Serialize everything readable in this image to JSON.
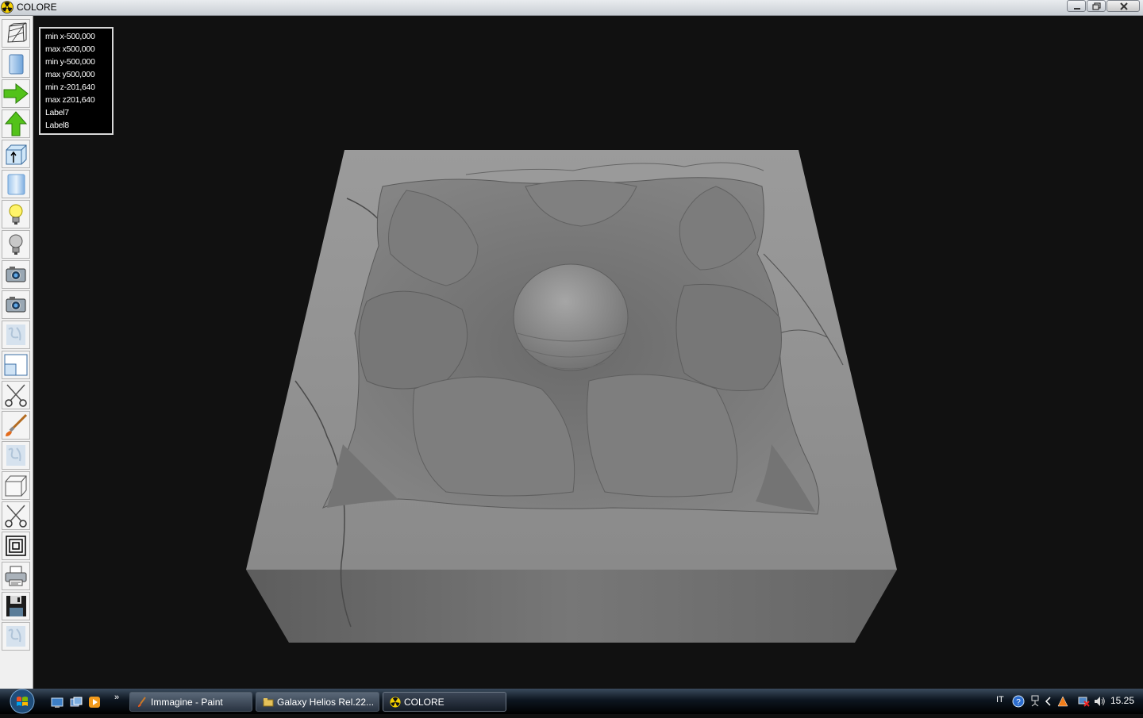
{
  "window": {
    "title": "COLORE",
    "controls": [
      "minimize",
      "maximize",
      "close"
    ]
  },
  "toolbar": {
    "tools": [
      {
        "name": "wireframe-view",
        "icon": "wireframe-icon"
      },
      {
        "name": "solid-view",
        "icon": "solid-block-icon"
      },
      {
        "name": "move-right",
        "icon": "arrow-right-icon"
      },
      {
        "name": "move-up",
        "icon": "arrow-up-icon"
      },
      {
        "name": "extrude",
        "icon": "box-arrow-icon"
      },
      {
        "name": "smooth-view",
        "icon": "cylinder-icon"
      },
      {
        "name": "light-on",
        "icon": "lightbulb-on-icon"
      },
      {
        "name": "light-off",
        "icon": "lightbulb-off-icon"
      },
      {
        "name": "camera-1",
        "icon": "camera-icon"
      },
      {
        "name": "camera-2",
        "icon": "camera-icon"
      },
      {
        "name": "marble-texture-1",
        "icon": "texture-icon"
      },
      {
        "name": "window-layout",
        "icon": "window-icon"
      },
      {
        "name": "cut-1",
        "icon": "scissors-icon"
      },
      {
        "name": "paint",
        "icon": "brush-icon"
      },
      {
        "name": "marble-texture-2",
        "icon": "texture-icon"
      },
      {
        "name": "cube",
        "icon": "cube-icon"
      },
      {
        "name": "cut-2",
        "icon": "scissors-icon"
      },
      {
        "name": "contour",
        "icon": "concentric-squares-icon"
      },
      {
        "name": "print",
        "icon": "printer-icon"
      },
      {
        "name": "save",
        "icon": "floppy-disk-icon"
      },
      {
        "name": "marble-texture-3",
        "icon": "texture-icon"
      }
    ]
  },
  "info": {
    "lines": [
      "min x-500,000",
      "max x500,000",
      "min y-500,000",
      "max y500,000",
      "min z-201,640",
      "max z201,640",
      "Label7",
      "Label8"
    ]
  },
  "taskbar": {
    "tasks": [
      {
        "label": "Immagine - Paint",
        "icon": "paint-icon",
        "active": false
      },
      {
        "label": "Galaxy Helios  Rel.22...",
        "icon": "folder-icon",
        "active": false
      },
      {
        "label": "COLORE",
        "icon": "radiation-icon",
        "active": true
      }
    ],
    "language": "IT",
    "clock": "15.25"
  },
  "colors": {
    "viewport_background": "#111111",
    "marble": "#8a8a8a",
    "toolbar_background": "#f0f0f0"
  }
}
